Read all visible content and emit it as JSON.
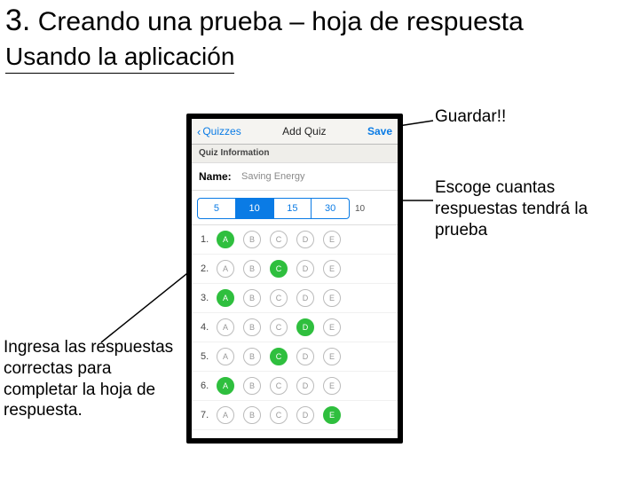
{
  "title_number": "3.",
  "title_text": "Creando una prueba – hoja de respuesta",
  "subtitle": "Usando la aplicación",
  "annotations": {
    "save": "Guardar!!",
    "count": "Escoge cuantas respuestas tendrá la prueba",
    "enter": "Ingresa las respuestas correctas para completar la hoja de respuesta."
  },
  "phone": {
    "nav_back": "Quizzes",
    "nav_title": "Add Quiz",
    "nav_save": "Save",
    "section": "Quiz Information",
    "name_label": "Name:",
    "name_value": "Saving Energy",
    "seg_options": [
      "5",
      "10",
      "15",
      "30"
    ],
    "seg_selected": 1,
    "seg_after": "10",
    "choices": [
      "A",
      "B",
      "C",
      "D",
      "E"
    ],
    "rows": [
      {
        "n": "1.",
        "sel": 0
      },
      {
        "n": "2.",
        "sel": 2
      },
      {
        "n": "3.",
        "sel": 0
      },
      {
        "n": "4.",
        "sel": 3
      },
      {
        "n": "5.",
        "sel": 2
      },
      {
        "n": "6.",
        "sel": 0
      },
      {
        "n": "7.",
        "sel": 4
      }
    ]
  }
}
